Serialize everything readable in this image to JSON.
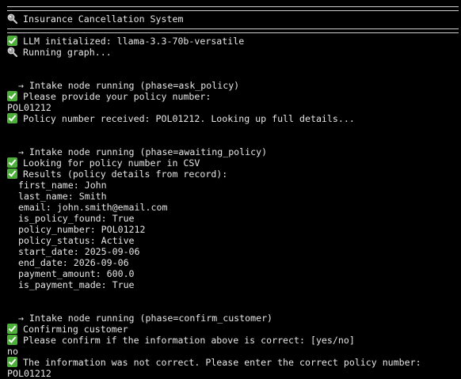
{
  "terminal": {
    "title": "Insurance Cancellation System",
    "lines": [
      {
        "type": "rule"
      },
      {
        "type": "icon",
        "icon": "magnifier-icon",
        "text": "Insurance Cancellation System"
      },
      {
        "type": "rule"
      },
      {
        "type": "icon",
        "icon": "check-icon",
        "text": "LLM initialized: llama-3.3-70b-versatile"
      },
      {
        "type": "icon",
        "icon": "magnifier-icon",
        "text": "Running graph..."
      },
      {
        "type": "blank"
      },
      {
        "type": "blank"
      },
      {
        "type": "text",
        "text": "  → Intake node running (phase=ask_policy)"
      },
      {
        "type": "icon",
        "icon": "check-icon",
        "text": "Please provide your policy number:"
      },
      {
        "type": "text",
        "text": "POL01212"
      },
      {
        "type": "icon",
        "icon": "check-icon",
        "text": "Policy number received: POL01212. Looking up full details..."
      },
      {
        "type": "blank"
      },
      {
        "type": "blank"
      },
      {
        "type": "text",
        "text": "  → Intake node running (phase=awaiting_policy)"
      },
      {
        "type": "icon",
        "icon": "check-icon",
        "text": "Looking for policy number in CSV"
      },
      {
        "type": "icon",
        "icon": "check-icon",
        "text": "Results (policy details from record):"
      },
      {
        "type": "text",
        "text": "  first_name: John"
      },
      {
        "type": "text",
        "text": "  last_name: Smith"
      },
      {
        "type": "text",
        "text": "  email: john.smith@email.com"
      },
      {
        "type": "text",
        "text": "  is_policy_found: True"
      },
      {
        "type": "text",
        "text": "  policy_number: POL01212"
      },
      {
        "type": "text",
        "text": "  policy_status: Active"
      },
      {
        "type": "text",
        "text": "  start_date: 2025-09-06"
      },
      {
        "type": "text",
        "text": "  end_date: 2026-09-06"
      },
      {
        "type": "text",
        "text": "  payment_amount: 600.0"
      },
      {
        "type": "text",
        "text": "  is_payment_made: True"
      },
      {
        "type": "blank"
      },
      {
        "type": "blank"
      },
      {
        "type": "text",
        "text": "  → Intake node running (phase=confirm_customer)"
      },
      {
        "type": "icon",
        "icon": "check-icon",
        "text": "Confirming customer"
      },
      {
        "type": "icon",
        "icon": "check-icon",
        "text": "Please confirm if the information above is correct: [yes/no]"
      },
      {
        "type": "text",
        "text": "no"
      },
      {
        "type": "icon",
        "icon": "check-icon",
        "text": "The information was not correct. Please enter the correct policy number:"
      },
      {
        "type": "text",
        "text": "POL01212"
      }
    ]
  },
  "colors": {
    "background": "#000000",
    "text": "#e6e6e6",
    "check_icon": "#4caf3a",
    "magnifier_icon": "#bfbfbf"
  }
}
